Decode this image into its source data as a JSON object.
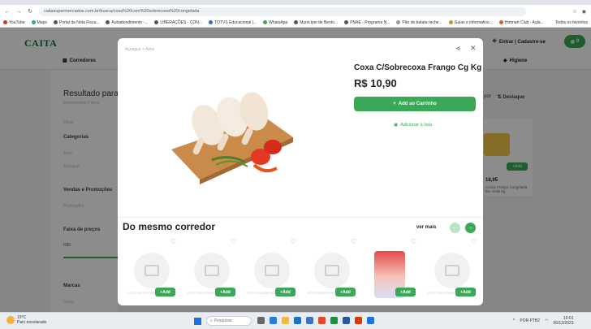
{
  "browser": {
    "url": "caitasupermercados.com.br/busca/coxa%20com%20sobrecoxa%20congelada",
    "bookmarks": [
      "YouTube",
      "Maps",
      "Portal da Nota Fisca...",
      "Autoatendimento -...",
      "LIBERAÇÕES - CON...",
      "TOTVS Educacional |...",
      "WhatsApp",
      "Município de Bento...",
      "PNAE - Programa N...",
      "Pão de batata reche...",
      "Guias e informativo...",
      "Hotmart Club - Aula..."
    ],
    "bookmarks_all": "Todos os favoritos"
  },
  "site": {
    "logo": "CAITA",
    "categories_button": "Corredores",
    "login": "Entrar | Cadastre-se",
    "cart_count": "0",
    "right_category": "Higiene",
    "results_title": "Resultado para",
    "results_sub": "Encontrados 9 itens",
    "filters": {
      "filter_label": "Filtrar",
      "categories": "Categorias",
      "cat1": "Aves",
      "cat2": "Açougue",
      "promos": "Vendas e Promoções",
      "promos_sub": "Promoções",
      "price_range": "Faixa de preços",
      "price_min": "R$0",
      "brands": "Marcas",
      "brand1": "Sadia"
    },
    "sort_prefix": "por",
    "sort_label": "Destaque",
    "bg_card": {
      "add": "Add",
      "price": "18,95",
      "name": "Cocxa Frango Congelada Bio Gallo kg"
    }
  },
  "modal": {
    "breadcrumb": "Açougue > Aves",
    "product_name": "Coxa C/Sobrecoxa Frango Cg Kg",
    "price": "R$ 10,90",
    "add_to_cart": "Add ao Carrinho",
    "add_to_list": "Adicionar à lista",
    "section_title": "Do mesmo corredor",
    "see_more": "ver mais",
    "cards": [
      {
        "photo_text": "FOTO INDISPONÍVEL",
        "add": "Add",
        "has_photo": false
      },
      {
        "photo_text": "FOTO INDISPONÍVEL",
        "add": "Add",
        "has_photo": false
      },
      {
        "photo_text": "FOTO INDISPONÍVEL",
        "add": "Add",
        "has_photo": false
      },
      {
        "photo_text": "FOTO INDISPONÍVEL",
        "add": "Add",
        "has_photo": false
      },
      {
        "photo_text": "",
        "add": "Add",
        "has_photo": true
      },
      {
        "photo_text": "FOTO INDISPONÍVEL",
        "add": "Add",
        "has_photo": false
      }
    ]
  },
  "taskbar": {
    "weather_temp": "19°C",
    "weather_desc": "Parc ensolarado",
    "search_placeholder": "Pesquisar",
    "lang": "POR PTB2",
    "time": "10:01",
    "date": "06/12/2023"
  }
}
